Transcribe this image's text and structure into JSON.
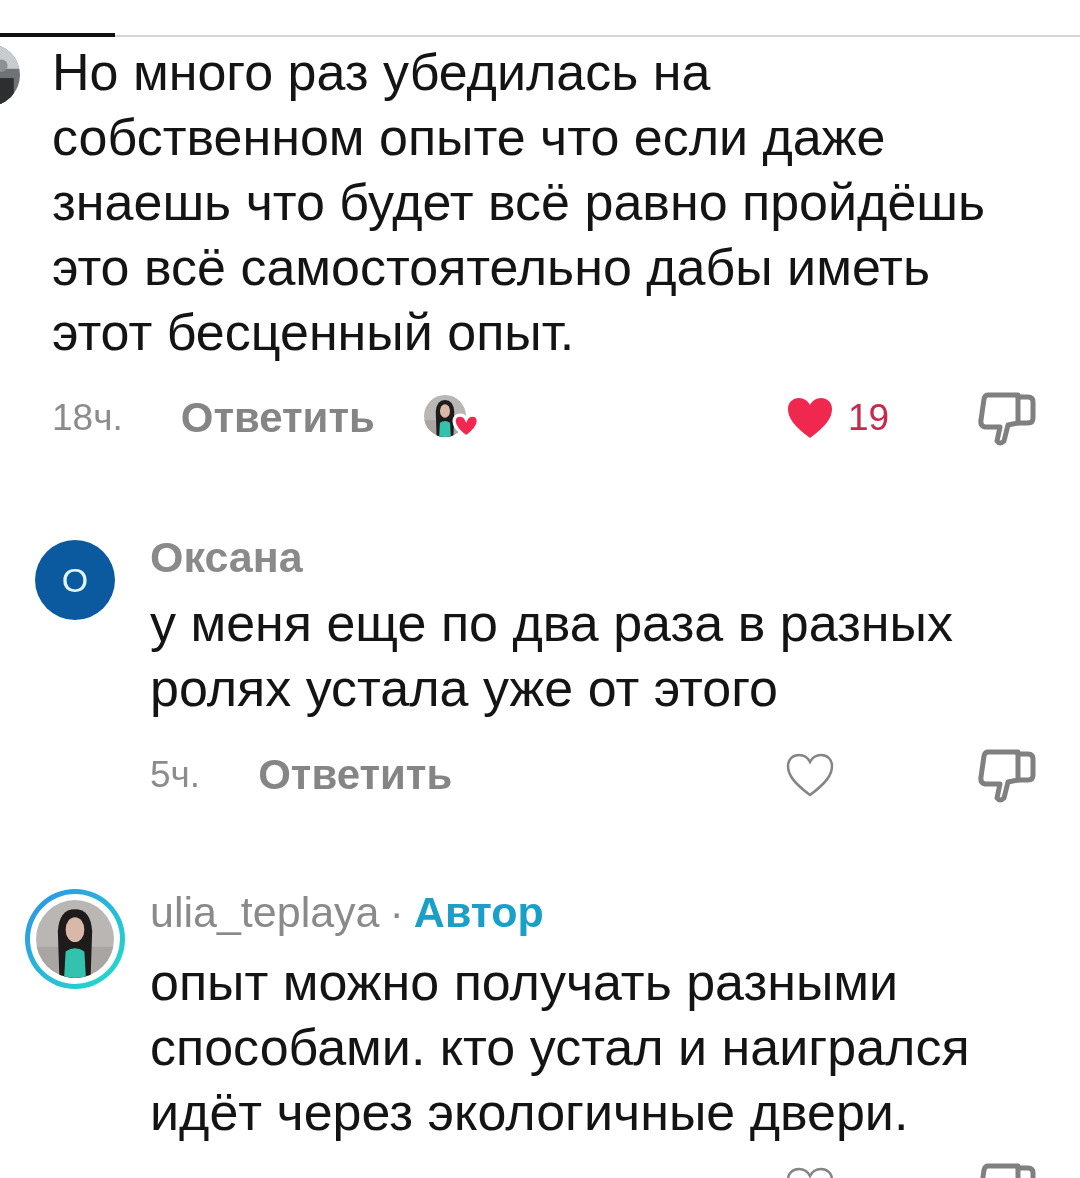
{
  "tabs_indicator": {
    "kind": "underline"
  },
  "comments": [
    {
      "avatar": {
        "kind": "picture",
        "cropped": true
      },
      "text": "Но много раз убедилась на\nсобственном опыте что если даже\nзнаешь что будет всё равно пройдёшь\nэто всё самостоятельно дабы иметь\nэтот бесценный опыт.",
      "time": "18ч.",
      "reply": "Ответить",
      "liked_by_author": true,
      "liked": true,
      "likes": "19"
    },
    {
      "avatar": {
        "kind": "initial",
        "letter": "О",
        "color": "#0b5aa0"
      },
      "name": "Оксана",
      "text": "у меня еще по два раза в разных\nролях устала уже от этого",
      "time": "5ч.",
      "reply": "Ответить",
      "liked_by_author": false,
      "liked": false
    },
    {
      "avatar": {
        "kind": "picture",
        "story_ring": true
      },
      "name": "ulia_teplaya",
      "separator": "·",
      "badge": "Автор",
      "text": "опыт можно получать разными\nспособами. кто устал и наигрался\nидёт через экологичные двери.",
      "liked_by_author": false,
      "liked": false
    }
  ]
}
